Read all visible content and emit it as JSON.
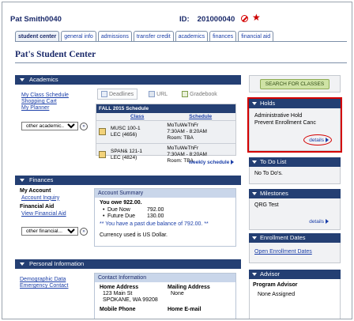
{
  "header": {
    "student_name": "Pat Smith0040",
    "id_label": "ID:",
    "id_value": "201000040",
    "hold_icon": "no-entry-icon",
    "star_icon": "star-icon"
  },
  "tabs": [
    "student center",
    "general info",
    "admissions",
    "transfer credit",
    "academics",
    "finances",
    "financial aid"
  ],
  "page_title": "Pat's Student Center",
  "academics": {
    "heading": "Academics",
    "links": [
      "My Class Schedule",
      "Shopping Cart",
      "My Planner"
    ],
    "select_value": "other academic...",
    "shortcuts": [
      "Deadlines",
      "URL",
      "Gradebook"
    ],
    "schedule_title": "FALL 2015 Schedule",
    "col_class": "Class",
    "col_schedule": "Schedule",
    "rows": [
      {
        "class1": "MUSC 100-1",
        "class2": "LEC (4656)",
        "sched1": "MoTuWeThFr",
        "sched2": "7:30AM - 8:20AM",
        "sched3": "Room:  TBA"
      },
      {
        "class1": "SPAN& 121-1",
        "class2": "LEC (4824)",
        "sched1": "MoTuWeThFr",
        "sched2": "7:30AM - 8:20AM",
        "sched3": "Room:  TBA"
      }
    ],
    "weekly_link": "weekly schedule"
  },
  "finances": {
    "heading": "Finances",
    "my_account": "My Account",
    "account_inquiry": "Account Inquiry",
    "financial_aid": "Financial Aid",
    "view_financial_aid": "View Financial Aid",
    "select_value": "other financial...",
    "summary_title": "Account Summary",
    "you_owe": "You owe 922.00.",
    "due_now_label": "Due Now",
    "due_now_value": "792.00",
    "future_due_label": "Future Due",
    "future_due_value": "130.00",
    "past_due": "** You have a past due balance of 792.00. **",
    "currency": "Currency used is US Dollar."
  },
  "personal": {
    "heading": "Personal Information",
    "links": [
      "Demographic Data",
      "Emergency Contact"
    ],
    "contact_title": "Contact Information",
    "home_address_label": "Home Address",
    "home_address_1": "123 Main St",
    "home_address_2": "SPOKANE, WA 99208",
    "mailing_address_label": "Mailing Address",
    "mailing_address_value": "None",
    "mobile_phone_label": "Mobile Phone",
    "home_email_label": "Home E-mail"
  },
  "sidebar": {
    "search_button": "SEARCH FOR CLASSES",
    "holds_heading": "Holds",
    "holds": [
      "Administrative Hold",
      "Prevent Enrollment Canc"
    ],
    "holds_details": "details",
    "todo_heading": "To Do List",
    "todo_text": "No To Do's.",
    "milestones_heading": "Milestones",
    "milestone_item": "QRG Test",
    "milestones_details": "details",
    "enrollment_heading": "Enrollment Dates",
    "enrollment_link": "Open Enrollment Dates",
    "advisor_heading": "Advisor",
    "advisor_label": "Program Advisor",
    "advisor_value": "None Assigned"
  },
  "colors": {
    "section_bar": "#243f73",
    "link": "#1a3ea8",
    "highlight_border": "#d40000",
    "search_button_bg": "#cfe3a5"
  }
}
